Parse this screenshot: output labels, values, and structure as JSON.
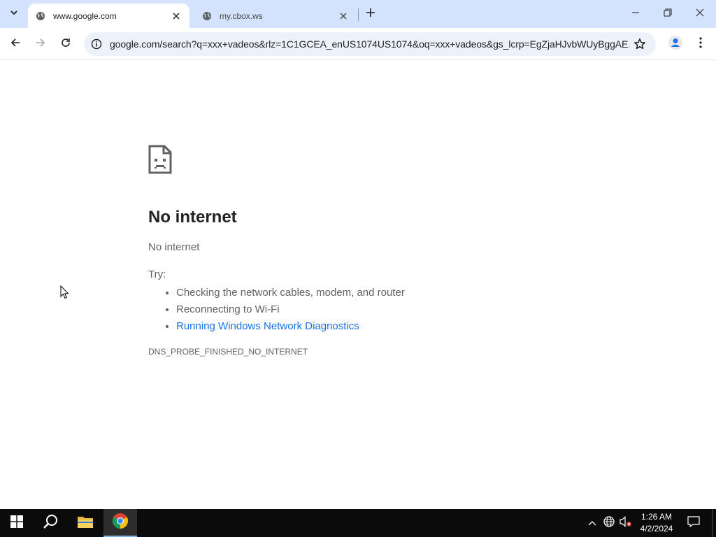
{
  "browser": {
    "tabs": [
      {
        "title": "www.google.com",
        "active": true
      },
      {
        "title": "my.cbox.ws",
        "active": false
      }
    ],
    "url": "google.com/search?q=xxx+vadeos&rlz=1C1GCEA_enUS1074US1074&oq=xxx+vadeos&gs_lcrp=EgZjaHJvbWUyBggAE..."
  },
  "error_page": {
    "title": "No internet",
    "subtitle": "No internet",
    "try_label": "Try:",
    "suggestions": [
      "Checking the network cables, modem, and router",
      "Reconnecting to Wi-Fi",
      "Running Windows Network Diagnostics"
    ],
    "error_code": "DNS_PROBE_FINISHED_NO_INTERNET"
  },
  "taskbar": {
    "time": "1:26 AM",
    "date": "4/2/2024"
  },
  "colors": {
    "tabstrip": "#d3e3fd",
    "omnibox": "#edf2fa",
    "link": "#1a73e8",
    "taskbar": "#0b0b0b"
  }
}
